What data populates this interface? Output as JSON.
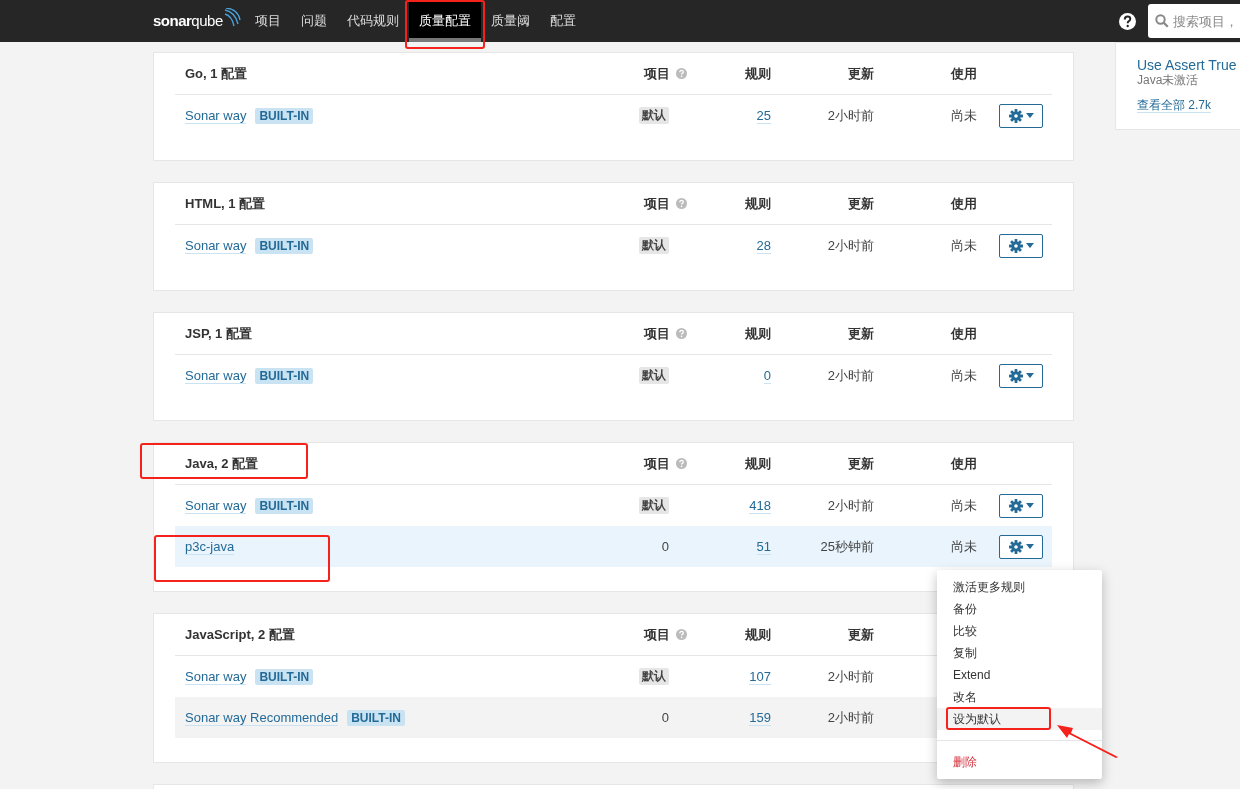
{
  "nav": {
    "logo": "**sonar**qube",
    "items": [
      {
        "label": "项目",
        "selected": false
      },
      {
        "label": "问题",
        "selected": false
      },
      {
        "label": "代码规则",
        "selected": false
      },
      {
        "label": "质量配置",
        "selected": true
      },
      {
        "label": "质量阈",
        "selected": false
      },
      {
        "label": "配置",
        "selected": false
      }
    ],
    "search": {
      "placeholder": "搜索项目，"
    }
  },
  "sidebar": {
    "items": [
      {
        "title": "Use Assert True",
        "subtitle": "Java未激活"
      }
    ],
    "link": "查看全部 2.7k"
  },
  "profile_groups": [
    {
      "title": "Go, 1 配置",
      "columns": [
        "项目",
        "规则",
        "更新",
        "使用"
      ],
      "profiles": [
        {
          "name": "Sonar way",
          "badge": "BUILT-IN",
          "projects": "默认",
          "is_default": true,
          "rules": "25",
          "updated": "2小时前",
          "usage": "尚未",
          "actions": true,
          "selected": false,
          "hovered": false
        }
      ]
    },
    {
      "title": "HTML, 1 配置",
      "columns": [
        "项目",
        "规则",
        "更新",
        "使用"
      ],
      "profiles": [
        {
          "name": "Sonar way",
          "badge": "BUILT-IN",
          "projects": "默认",
          "is_default": true,
          "rules": "28",
          "updated": "2小时前",
          "usage": "尚未",
          "actions": true,
          "selected": false,
          "hovered": false
        }
      ]
    },
    {
      "title": "JSP, 1 配置",
      "columns": [
        "项目",
        "规则",
        "更新",
        "使用"
      ],
      "profiles": [
        {
          "name": "Sonar way",
          "badge": "BUILT-IN",
          "projects": "默认",
          "is_default": true,
          "rules": "0",
          "updated": "2小时前",
          "usage": "尚未",
          "actions": true,
          "selected": false,
          "hovered": false
        }
      ]
    },
    {
      "title": "Java, 2 配置",
      "columns": [
        "项目",
        "规则",
        "更新",
        "使用"
      ],
      "profiles": [
        {
          "name": "Sonar way",
          "badge": "BUILT-IN",
          "projects": "默认",
          "is_default": true,
          "rules": "418",
          "updated": "2小时前",
          "usage": "尚未",
          "actions": true,
          "selected": false,
          "hovered": false
        },
        {
          "name": "p3c-java",
          "projects": "0",
          "is_default": false,
          "rules": "51",
          "updated": "25秒钟前",
          "usage": "尚未",
          "actions": true,
          "selected": true,
          "hovered": false
        }
      ]
    },
    {
      "title": "JavaScript, 2 配置",
      "columns": [
        "项目",
        "规则",
        "更新"
      ],
      "profiles": [
        {
          "name": "Sonar way",
          "badge": "BUILT-IN",
          "projects": "默认",
          "is_default": true,
          "rules": "107",
          "updated": "2小时前",
          "selected": false,
          "hovered": false
        },
        {
          "name": "Sonar way Recommended",
          "badge": "BUILT-IN",
          "projects": "0",
          "is_default": false,
          "rules": "159",
          "updated": "2小时前",
          "selected": false,
          "hovered": true
        }
      ]
    }
  ],
  "menu": {
    "items": [
      {
        "label": "激活更多规则",
        "kind": "normal",
        "hovered": false
      },
      {
        "label": "备份",
        "kind": "normal",
        "hovered": false
      },
      {
        "label": "比较",
        "kind": "normal",
        "hovered": false
      },
      {
        "label": "复制",
        "kind": "normal",
        "hovered": false
      },
      {
        "label": "Extend",
        "kind": "normal",
        "hovered": false
      },
      {
        "label": "改名",
        "kind": "normal",
        "hovered": false
      },
      {
        "label": "设为默认",
        "kind": "normal",
        "hovered": true
      },
      {
        "label": "删除",
        "kind": "danger",
        "hovered": false
      }
    ]
  }
}
